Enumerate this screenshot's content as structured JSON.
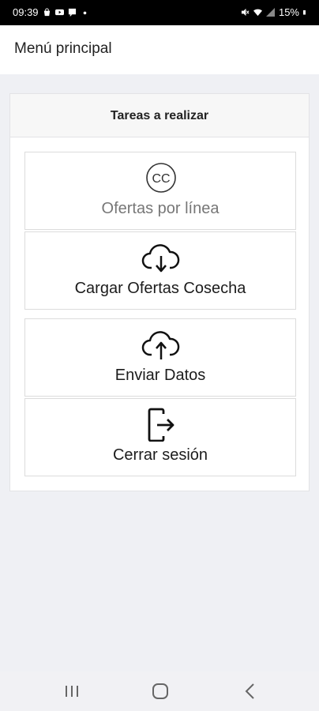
{
  "status_bar": {
    "time": "09:39",
    "battery": "15%",
    "icons": [
      "bag-icon",
      "youtube-icon",
      "message-icon",
      "dot-icon",
      "mute-icon",
      "wifi-icon",
      "signal-icon",
      "battery-icon"
    ]
  },
  "header": {
    "title": "Menú principal"
  },
  "card": {
    "title": "Tareas a realizar"
  },
  "tasks": [
    {
      "label": "Ofertas por línea",
      "icon": "closed-captions-icon",
      "state": "disabled",
      "icon_text": "CC"
    },
    {
      "label": "Cargar Ofertas Cosecha",
      "icon": "cloud-download-icon",
      "state": "enabled"
    },
    {
      "label": "Enviar Datos",
      "icon": "cloud-upload-icon",
      "state": "enabled"
    },
    {
      "label": "Cerrar sesión",
      "icon": "logout-icon",
      "state": "enabled"
    }
  ],
  "nav_bar": {
    "buttons": [
      "recent-apps-icon",
      "home-icon",
      "back-icon"
    ]
  },
  "colors": {
    "background": "#eff0f4",
    "card": "#ffffff",
    "card_header": "#f7f7f7",
    "text": "#1c1c1c",
    "disabled_text": "#777777"
  }
}
